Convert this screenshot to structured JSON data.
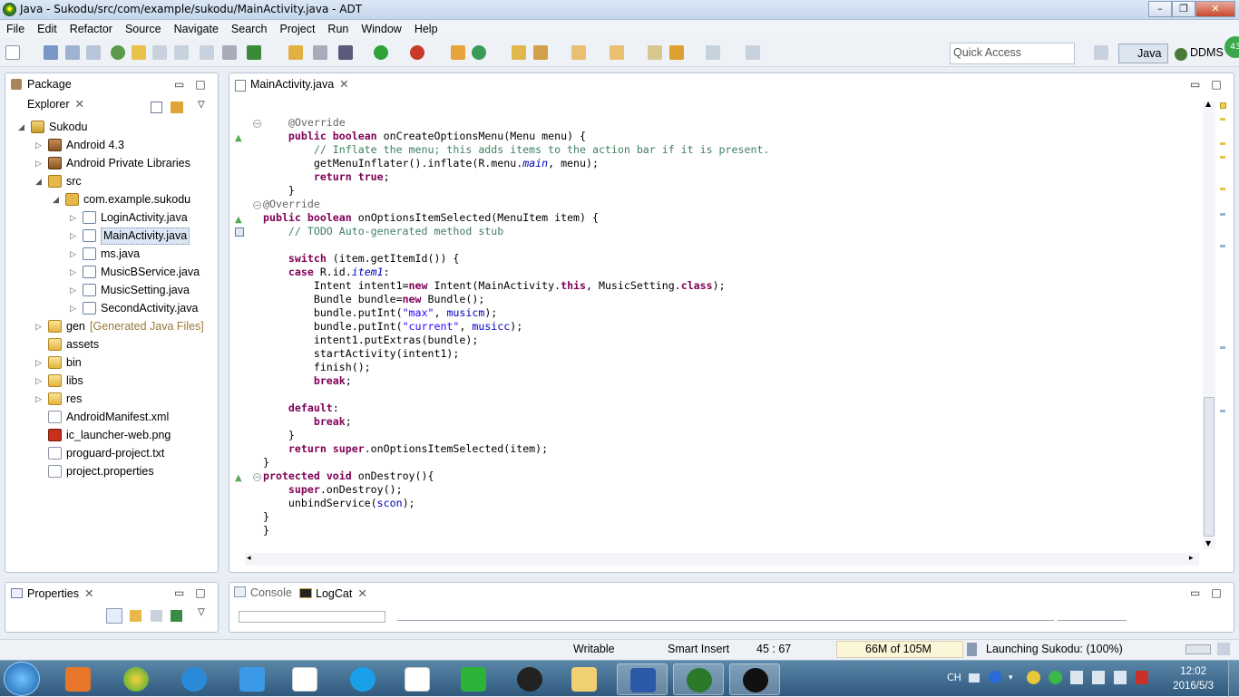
{
  "window": {
    "title": "Java - Sukodu/src/com/example/sukodu/MainActivity.java - ADT"
  },
  "menu": [
    "File",
    "Edit",
    "Refactor",
    "Source",
    "Navigate",
    "Search",
    "Project",
    "Run",
    "Window",
    "Help"
  ],
  "quick_access": {
    "placeholder": "Quick Access"
  },
  "perspectives": {
    "java": "Java",
    "ddms": "DDMS"
  },
  "package_explorer": {
    "tab": "Package Explorer",
    "items": [
      {
        "label": "Sukodu",
        "depth": 0,
        "icon": "project-icon",
        "twisty": "expanded"
      },
      {
        "label": "Android 4.3",
        "depth": 1,
        "icon": "library-icon",
        "twisty": "collapsed"
      },
      {
        "label": "Android Private Libraries",
        "depth": 1,
        "icon": "library-icon",
        "twisty": "collapsed"
      },
      {
        "label": "src",
        "depth": 1,
        "icon": "source-folder-icon",
        "twisty": "expanded"
      },
      {
        "label": "com.example.sukodu",
        "depth": 2,
        "icon": "package-icon",
        "twisty": "expanded"
      },
      {
        "label": "LoginActivity.java",
        "depth": 3,
        "icon": "java-file-icon",
        "twisty": "collapsed"
      },
      {
        "label": "MainActivity.java",
        "depth": 3,
        "icon": "java-file-icon",
        "twisty": "collapsed",
        "selected": true
      },
      {
        "label": "ms.java",
        "depth": 3,
        "icon": "java-file-icon",
        "twisty": "collapsed"
      },
      {
        "label": "MusicBService.java",
        "depth": 3,
        "icon": "java-file-icon",
        "twisty": "collapsed"
      },
      {
        "label": "MusicSetting.java",
        "depth": 3,
        "icon": "java-file-icon",
        "twisty": "collapsed"
      },
      {
        "label": "SecondActivity.java",
        "depth": 3,
        "icon": "java-file-icon",
        "twisty": "collapsed"
      },
      {
        "label": "gen",
        "suffix": "[Generated Java Files]",
        "depth": 1,
        "icon": "folder-icon",
        "twisty": "collapsed"
      },
      {
        "label": "assets",
        "depth": 1,
        "icon": "folder-icon",
        "twisty": "none"
      },
      {
        "label": "bin",
        "depth": 1,
        "icon": "folder-icon",
        "twisty": "collapsed"
      },
      {
        "label": "libs",
        "depth": 1,
        "icon": "folder-icon",
        "twisty": "collapsed"
      },
      {
        "label": "res",
        "depth": 1,
        "icon": "folder-icon",
        "twisty": "collapsed"
      },
      {
        "label": "AndroidManifest.xml",
        "depth": 1,
        "icon": "xml-file-icon",
        "twisty": "none"
      },
      {
        "label": "ic_launcher-web.png",
        "depth": 1,
        "icon": "image-file-icon",
        "twisty": "none"
      },
      {
        "label": "proguard-project.txt",
        "depth": 1,
        "icon": "text-file-icon",
        "twisty": "none"
      },
      {
        "label": "project.properties",
        "depth": 1,
        "icon": "text-file-icon",
        "twisty": "none"
      }
    ]
  },
  "editor": {
    "tab": "MainActivity.java",
    "lines": [
      [
        [
          "an",
          "    @Override"
        ]
      ],
      [
        [
          "",
          "    "
        ],
        [
          "kw",
          "public"
        ],
        [
          "",
          " "
        ],
        [
          "kw",
          "boolean"
        ],
        [
          "",
          " onCreateOptionsMenu(Menu menu) {"
        ]
      ],
      [
        [
          "cm",
          "        // Inflate the menu; this adds items to the action bar if it is present."
        ]
      ],
      [
        [
          "",
          "        getMenuInflater().inflate(R.menu."
        ],
        [
          "fld it",
          "main"
        ],
        [
          "",
          ", menu);"
        ]
      ],
      [
        [
          "",
          "        "
        ],
        [
          "kw",
          "return"
        ],
        [
          "",
          " "
        ],
        [
          "kw",
          "true"
        ],
        [
          "",
          ";"
        ]
      ],
      [
        [
          "",
          "    }"
        ]
      ],
      [
        [
          "an",
          "@Override"
        ]
      ],
      [
        [
          "kw",
          "public"
        ],
        [
          "",
          " "
        ],
        [
          "kw",
          "boolean"
        ],
        [
          "",
          " onOptionsItemSelected(MenuItem item) {"
        ]
      ],
      [
        [
          "cm",
          "    // TODO Auto-generated method stub"
        ]
      ],
      [
        [
          "",
          ""
        ]
      ],
      [
        [
          "",
          "    "
        ],
        [
          "kw",
          "switch"
        ],
        [
          "",
          " (item.getItemId()) {"
        ]
      ],
      [
        [
          "",
          "    "
        ],
        [
          "kw",
          "case"
        ],
        [
          "",
          " R.id."
        ],
        [
          "fld it",
          "item1"
        ],
        [
          "",
          ":"
        ]
      ],
      [
        [
          "",
          "        Intent intent1="
        ],
        [
          "kw",
          "new"
        ],
        [
          "",
          " Intent(MainActivity."
        ],
        [
          "kw",
          "this"
        ],
        [
          "",
          ", MusicSetting."
        ],
        [
          "kw",
          "class"
        ],
        [
          "",
          ");"
        ]
      ],
      [
        [
          "",
          "        Bundle bundle="
        ],
        [
          "kw",
          "new"
        ],
        [
          "",
          " Bundle();"
        ]
      ],
      [
        [
          "",
          "        bundle.putInt("
        ],
        [
          "str",
          "\"max\""
        ],
        [
          "",
          ", "
        ],
        [
          "fld",
          "musicm"
        ],
        [
          "",
          ");"
        ]
      ],
      [
        [
          "",
          "        bundle.putInt("
        ],
        [
          "str",
          "\"current\""
        ],
        [
          "",
          ", "
        ],
        [
          "fld",
          "musicc"
        ],
        [
          "",
          ");"
        ]
      ],
      [
        [
          "",
          "        intent1.putExtras(bundle);"
        ]
      ],
      [
        [
          "",
          "        startActivity(intent1);"
        ]
      ],
      [
        [
          "",
          "        finish();"
        ]
      ],
      [
        [
          "",
          "        "
        ],
        [
          "kw",
          "break"
        ],
        [
          "",
          ";"
        ]
      ],
      [
        [
          "",
          ""
        ]
      ],
      [
        [
          "",
          "    "
        ],
        [
          "kw",
          "default"
        ],
        [
          "",
          ":"
        ]
      ],
      [
        [
          "",
          "        "
        ],
        [
          "kw",
          "break"
        ],
        [
          "",
          ";"
        ]
      ],
      [
        [
          "",
          "    }"
        ]
      ],
      [
        [
          "",
          "    "
        ],
        [
          "kw",
          "return"
        ],
        [
          "",
          " "
        ],
        [
          "kw",
          "super"
        ],
        [
          "",
          ".onOptionsItemSelected(item);"
        ]
      ],
      [
        [
          "",
          "}"
        ]
      ],
      [
        [
          "kw",
          "protected"
        ],
        [
          "",
          " "
        ],
        [
          "kw",
          "void"
        ],
        [
          "",
          " onDestroy(){"
        ]
      ],
      [
        [
          "",
          "    "
        ],
        [
          "kw",
          "super"
        ],
        [
          "",
          ".onDestroy();"
        ]
      ],
      [
        [
          "",
          "    unbindService("
        ],
        [
          "fld",
          "scon"
        ],
        [
          "",
          ");"
        ]
      ],
      [
        [
          "",
          "}"
        ]
      ],
      [
        [
          "",
          "}"
        ]
      ]
    ]
  },
  "properties": {
    "tab": "Properties"
  },
  "console_tabs": {
    "console": "Console",
    "logcat": "LogCat"
  },
  "status": {
    "writable": "Writable",
    "insert_mode": "Smart Insert",
    "position": "45 : 67",
    "memory": "66M of 105M",
    "progress_text": "Launching Sukodu: (100%)",
    "progress": 1.0
  },
  "taskbar": {
    "time": "12:02",
    "date": "2016/5/3",
    "lang": "CH"
  },
  "colors": {
    "keyword": "#7f0055",
    "comment": "#3f7f5f",
    "string": "#2a00ff",
    "field": "#0000c0",
    "annotation": "#646464"
  }
}
